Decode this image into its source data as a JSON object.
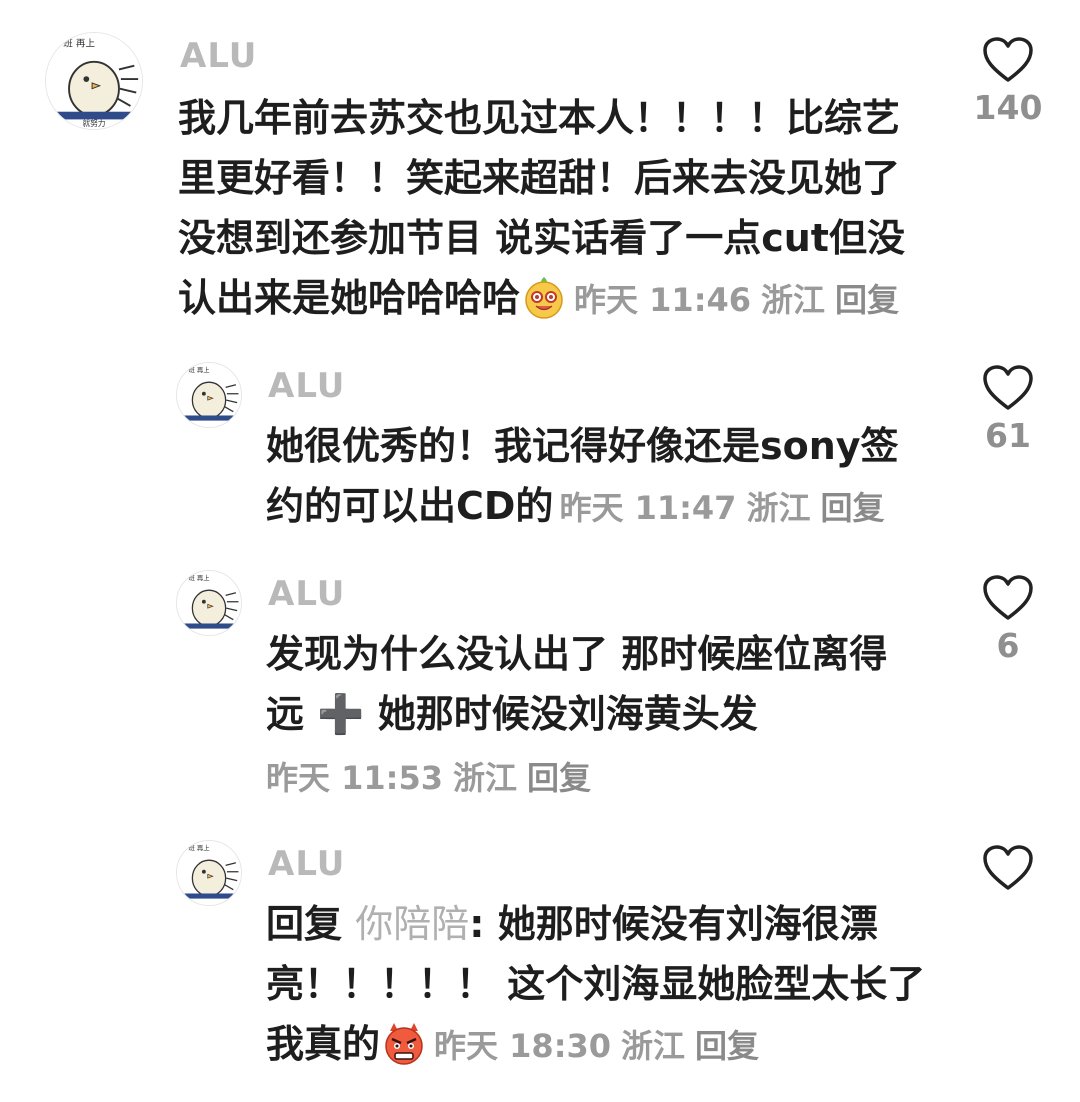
{
  "comments": [
    {
      "username": "ALU",
      "text": "我几年前去苏交也见过本人！！！！比综艺里更好看！！笑起来超甜！后来去没见她了没想到还参加节目 说实话看了一点cut但没认出来是她哈哈哈哈",
      "emoji": "laughing-face-emoji",
      "time": "昨天 11:46",
      "location": "浙江",
      "reply_label": "回复",
      "likes": "140"
    },
    {
      "username": "ALU",
      "text": "她很优秀的！我记得好像还是sony签约的可以出CD的",
      "time": "昨天 11:47",
      "location": "浙江",
      "reply_label": "回复",
      "likes": "61"
    },
    {
      "username": "ALU",
      "text": "发现为什么没认出了 那时候座位离得远 ➕ 她那时候没刘海黄头发",
      "time": "昨天 11:53",
      "location": "浙江",
      "reply_label": "回复",
      "likes": "6"
    },
    {
      "username": "ALU",
      "reply_prefix": "回复",
      "mention": "你陪陪",
      "text": ": 她那时候没有刘海很漂亮！！！！！ 这个刘海显她脸型太长了 我真的",
      "emoji": "angry-devil-face-emoji",
      "time": "昨天 18:30",
      "location": "浙江",
      "reply_label": "回复",
      "likes": ""
    }
  ],
  "avatar_text": {
    "top": "班 再上",
    "bottom": "就努力"
  },
  "icons": {
    "like": "heart-outline-icon"
  },
  "colors": {
    "username": "#b9b9b9",
    "text": "#1e1e1e",
    "meta": "#9a9a9a",
    "heart": "#222222"
  }
}
